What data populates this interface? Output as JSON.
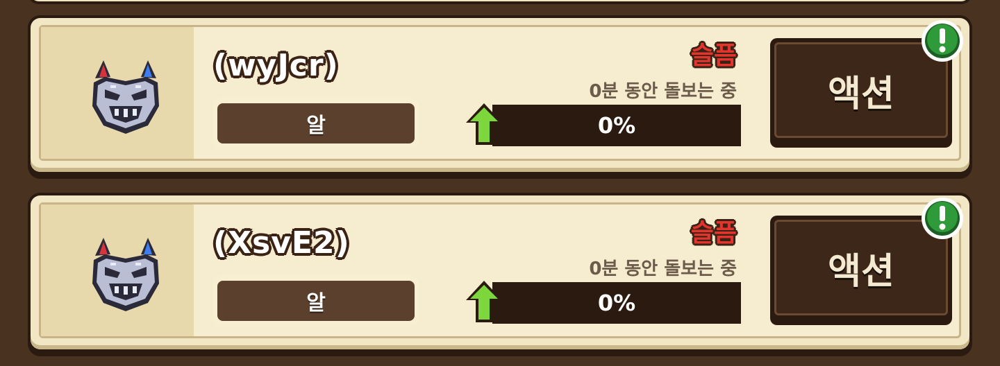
{
  "pets": [
    {
      "name": "(wyJcr)",
      "stage": "알",
      "mood": "슬픔",
      "care_status": "0분 동안 돌보는 중",
      "progress": 0,
      "progress_label": "0%",
      "action_label": "액션",
      "avatar_icon": "demon-mask-icon",
      "alert_icon": "exclamation-badge-icon"
    },
    {
      "name": "(XsvE2)",
      "stage": "알",
      "mood": "슬픔",
      "care_status": "0분 동안 돌보는 중",
      "progress": 0,
      "progress_label": "0%",
      "action_label": "액션",
      "avatar_icon": "demon-mask-icon",
      "alert_icon": "exclamation-badge-icon"
    }
  ],
  "colors": {
    "background": "#4a3221",
    "card": "#f2e7c5",
    "mood_text": "#e3342e",
    "progress_arrow": "#7cd63c",
    "alert_badge": "#2e9a3a"
  }
}
